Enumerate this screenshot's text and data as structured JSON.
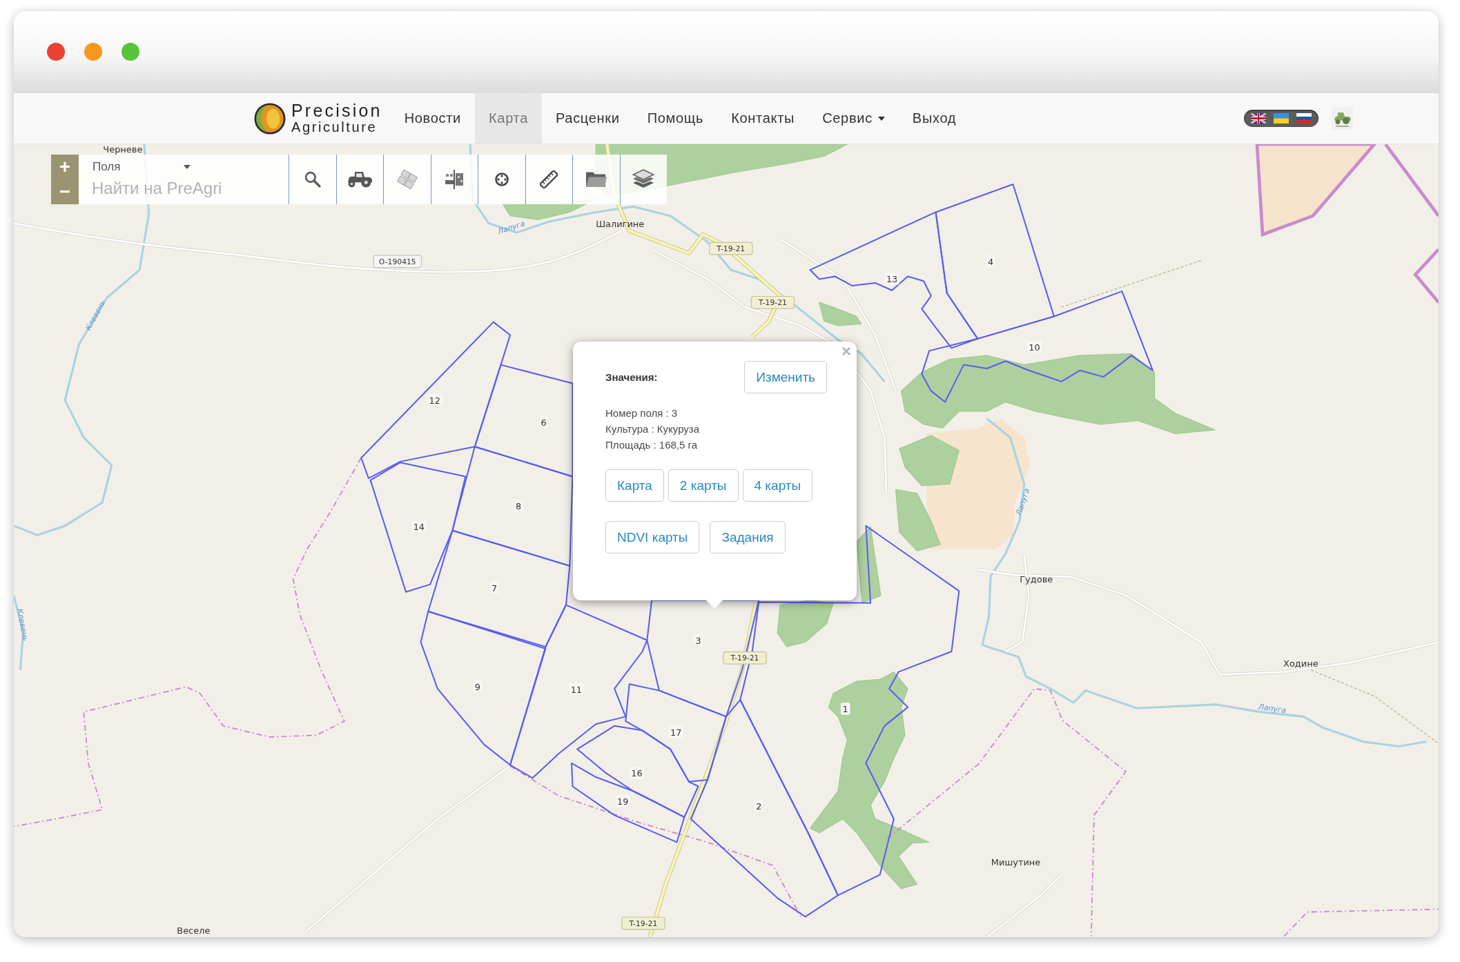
{
  "window": {
    "controls": [
      {
        "color": "#ee4136"
      },
      {
        "color": "#f7981d"
      },
      {
        "color": "#57c53a"
      }
    ]
  },
  "navbar": {
    "brand": {
      "line_1": "Precision",
      "line_2": "Agriculture"
    },
    "items": [
      {
        "label": "Новости",
        "selected": false,
        "dropdown": false
      },
      {
        "label": "Карта",
        "selected": true,
        "dropdown": false
      },
      {
        "label": "Расценки",
        "selected": false,
        "dropdown": false
      },
      {
        "label": "Помощь",
        "selected": false,
        "dropdown": false
      },
      {
        "label": "Контакты",
        "selected": false,
        "dropdown": false
      },
      {
        "label": "Сервис",
        "selected": false,
        "dropdown": true
      },
      {
        "label": "Выход",
        "selected": false,
        "dropdown": false
      }
    ],
    "languages": [
      {
        "kind": "en"
      },
      {
        "kind": "uk"
      },
      {
        "kind": "ru"
      }
    ]
  },
  "map_toolbar": {
    "zoom_in": "+",
    "zoom_out": "−",
    "layer_select": "Поля",
    "search": {
      "placeholder": "Найти на PreAgri"
    }
  },
  "map": {
    "places": [
      "Черневе",
      "Шалигине",
      "Гудове",
      "Ходине",
      "Мишутине",
      "Веселе"
    ],
    "road_shields": [
      {
        "kind": "local",
        "label": "O-190415"
      },
      {
        "kind": "highway",
        "label": "T-19-21"
      },
      {
        "kind": "highway",
        "label": "T-19-21"
      },
      {
        "kind": "highway",
        "label": "T-19-21"
      },
      {
        "kind": "highway",
        "label": "T-19-21"
      }
    ],
    "river_labels": [
      "Лапуга",
      "Лапуга",
      "Лапуга",
      "Клевень",
      "Клевень"
    ],
    "fields": [
      {
        "label": "4"
      },
      {
        "label": "13"
      },
      {
        "label": "10"
      },
      {
        "label": "12"
      },
      {
        "label": "6"
      },
      {
        "label": "8"
      },
      {
        "label": "14"
      },
      {
        "label": "7"
      },
      {
        "label": "3"
      },
      {
        "label": "1"
      },
      {
        "label": "9"
      },
      {
        "label": "11"
      },
      {
        "label": "17"
      },
      {
        "label": "16"
      },
      {
        "label": "19"
      },
      {
        "label": "2"
      }
    ]
  },
  "popup": {
    "close": "×",
    "heading": "Значения:",
    "edit_button": "Изменить",
    "details": [
      "Номер поля : 3",
      "Культура : Кукуруза",
      "Площадь : 168,5 га"
    ],
    "button_rows": [
      {
        "buttons": [
          "Карта",
          "2 карты",
          "4 карты"
        ]
      },
      {
        "buttons": [
          "NDVI карты",
          "Задания"
        ]
      }
    ]
  }
}
